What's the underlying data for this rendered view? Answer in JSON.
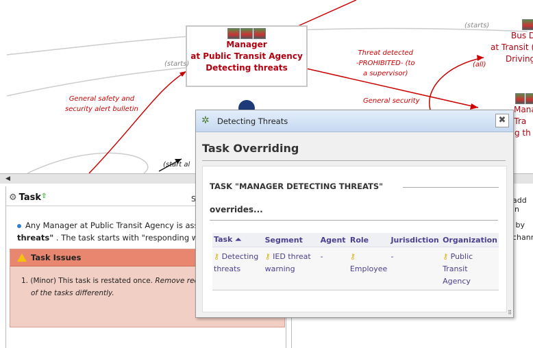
{
  "graph": {
    "node_manager": [
      "Manager",
      "at Public Transit Agency",
      "Detecting threats"
    ],
    "node_bus": [
      "Bus D",
      "at Transit (",
      "Driving"
    ],
    "node_mana": [
      "Mana",
      "c Tra",
      "ing th"
    ],
    "edge_general_safety": [
      "General safety and",
      "security alert bulletin"
    ],
    "edge_threat": [
      "Threat detected",
      "-PROHIBITED- (to",
      "a supervisor)"
    ],
    "edge_general_security": "General security",
    "label_starts_left": "(starts)",
    "label_starts_right": "(starts)",
    "label_all": "(all)",
    "label_start_al": "(start al"
  },
  "task_panel": {
    "title": "Task",
    "partial_letter": "S",
    "description_1": "Any Manager at Public Transit Agency is assig",
    "description_2_bold": "threats\"",
    "description_2_rest": ". The task starts with \"responding whi",
    "issues_title": "Task Issues",
    "issue_text": "1.  (Minor) This task is restated once.",
    "issue_italic": "Remove redur",
    "issue_line2": "of the tasks differently."
  },
  "right_panel": {
    "add_in": "add in",
    "by": "\" by",
    "chann": "chann"
  },
  "dialog": {
    "window_title": "Detecting Threats",
    "close_symbol": "✖",
    "heading": "Task Overriding",
    "section_title": "TASK \"MANAGER DETECTING THREATS\"",
    "overrides_label": "overrides...",
    "table": {
      "headers": [
        "Task ⏶",
        "Segment",
        "Agent",
        "Role",
        "Jurisdiction",
        "Organization"
      ],
      "rows": [
        [
          "Detecting threats",
          "IED threat warning",
          "-",
          "Employee",
          "-",
          "Public Transit Agency"
        ]
      ]
    }
  },
  "colors": {
    "node_text": "#b3000f",
    "edge_red": "#c00",
    "issue_header": "#e98670",
    "issue_body": "#f2cfc4",
    "link_purple": "#4b3f8f"
  }
}
